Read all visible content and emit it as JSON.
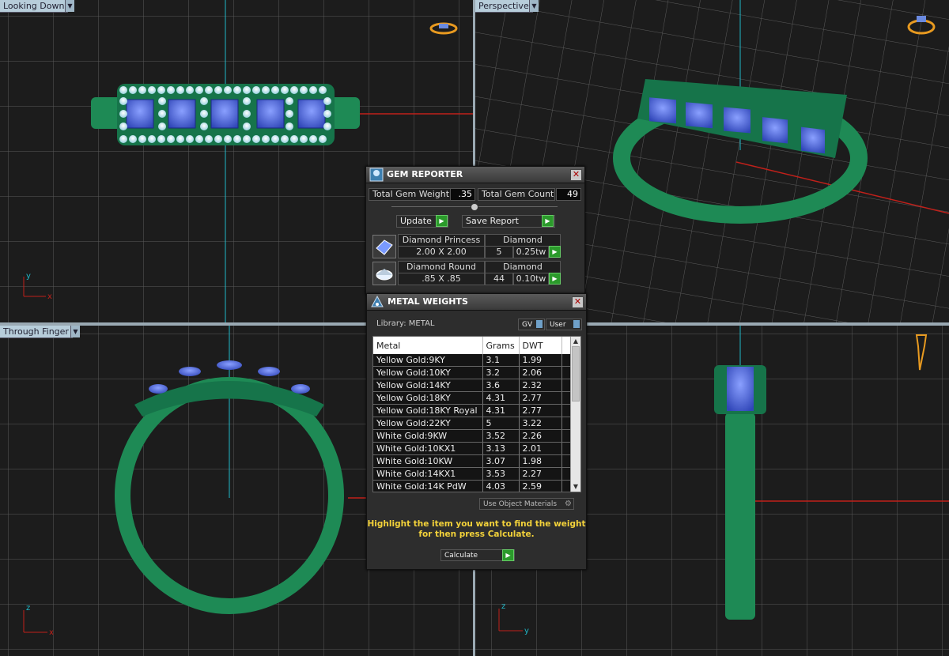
{
  "viewports": {
    "top_left": "Looking Down",
    "top_right": "Perspective",
    "bottom_left": "Through Finger"
  },
  "axes": {
    "tl": {
      "a": "y",
      "b": "x"
    },
    "bl": {
      "a": "z",
      "b": "x"
    },
    "br": {
      "a": "z",
      "b": "y"
    }
  },
  "gem_reporter": {
    "title": "GEM REPORTER",
    "total_weight_label": "Total Gem Weight",
    "total_weight_value": ".35",
    "total_count_label": "Total Gem Count",
    "total_count_value": "49",
    "update_label": "Update",
    "save_label": "Save Report",
    "gems": [
      {
        "name": "Diamond Princess",
        "size": "2.00 X 2.00",
        "material": "Diamond",
        "count": "5",
        "tw": "0.25tw"
      },
      {
        "name": "Diamond Round",
        "size": ".85 X .85",
        "material": "Diamond",
        "count": "44",
        "tw": "0.10tw"
      }
    ]
  },
  "metal_weights": {
    "title": "METAL WEIGHTS",
    "library_label": "Library: METAL",
    "gv_label": "GV",
    "user_label": "User",
    "columns": [
      "Metal",
      "Grams",
      "DWT"
    ],
    "rows": [
      [
        "Yellow Gold:9KY",
        "3.1",
        "1.99"
      ],
      [
        "Yellow Gold:10KY",
        "3.2",
        "2.06"
      ],
      [
        "Yellow Gold:14KY",
        "3.6",
        "2.32"
      ],
      [
        "Yellow Gold:18KY",
        "4.31",
        "2.77"
      ],
      [
        "Yellow Gold:18KY Royal",
        "4.31",
        "2.77"
      ],
      [
        "Yellow Gold:22KY",
        "5",
        "3.22"
      ],
      [
        "White Gold:9KW",
        "3.52",
        "2.26"
      ],
      [
        "White Gold:10KX1",
        "3.13",
        "2.01"
      ],
      [
        "White Gold:10KW",
        "3.07",
        "1.98"
      ],
      [
        "White Gold:14KX1",
        "3.53",
        "2.27"
      ],
      [
        "White Gold:14K PdW",
        "4.03",
        "2.59"
      ]
    ],
    "use_object_label": "Use Object Materials",
    "message_line1": "Highlight the item you want to find the weight",
    "message_line2": "for then press Calculate.",
    "calculate_label": "Calculate"
  },
  "colors": {
    "metal": "#1e8a55",
    "gem": "#4f6fe0",
    "grid_bg": "#1c1c1c",
    "axis_red": "#c0201a",
    "axis_cyan": "#20b8c8",
    "message": "#f3d23a",
    "green_button": "#2b9a2b"
  }
}
